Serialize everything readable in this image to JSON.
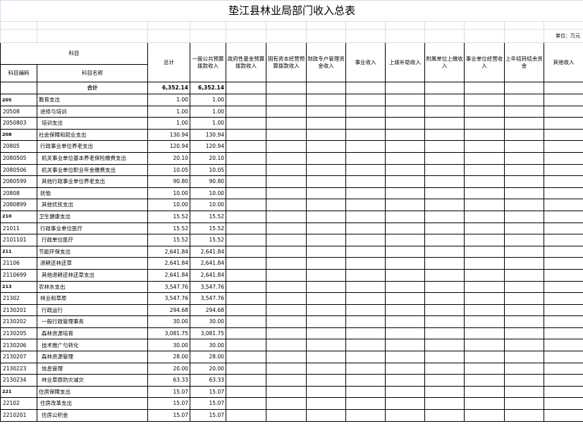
{
  "title": "垫江县林业局部门收入总表",
  "unit_label": "单位：万元",
  "headers": {
    "subject": "科目",
    "subject_code": "科目编码",
    "subject_name": "科目名称",
    "columns": [
      "总计",
      "一般公共预算拨款收入",
      "政府性基金预算拨款收入",
      "国有资本经营预算拨款收入",
      "财政专户管理资金收入",
      "事业收入",
      "上级补助收入",
      "附属单位上缴收入",
      "事业单位经营收入",
      "上年结转结余资金",
      "其他收入"
    ]
  },
  "total_row": {
    "label": "合计",
    "total": "6,352.14",
    "general": "6,352.14"
  },
  "rows": [
    {
      "code": "205",
      "name": "教育支出",
      "total": "1.00",
      "general": "1.00",
      "level": 1
    },
    {
      "code": "20508",
      "name": "进修与培训",
      "total": "1.00",
      "general": "1.00",
      "level": 2
    },
    {
      "code": "2050803",
      "name": "培训支出",
      "total": "1.00",
      "general": "1.00",
      "level": 3
    },
    {
      "code": "208",
      "name": "社会保障和就业支出",
      "total": "130.94",
      "general": "130.94",
      "level": 1
    },
    {
      "code": "20805",
      "name": "行政事业单位养老支出",
      "total": "120.94",
      "general": "120.94",
      "level": 2
    },
    {
      "code": "2080505",
      "name": "机关事业单位基本养老保险缴费支出",
      "total": "20.10",
      "general": "20.10",
      "level": 3
    },
    {
      "code": "2080506",
      "name": "机关事业单位职业年金缴费支出",
      "total": "10.05",
      "general": "10.05",
      "level": 3
    },
    {
      "code": "2080599",
      "name": "其他行政事业单位养老支出",
      "total": "90.80",
      "general": "90.80",
      "level": 3
    },
    {
      "code": "20808",
      "name": "抚恤",
      "total": "10.00",
      "general": "10.00",
      "level": 2
    },
    {
      "code": "2080899",
      "name": "其他优抚支出",
      "total": "10.00",
      "general": "10.00",
      "level": 3
    },
    {
      "code": "210",
      "name": "卫生健康支出",
      "total": "15.52",
      "general": "15.52",
      "level": 1
    },
    {
      "code": "21011",
      "name": "行政事业单位医疗",
      "total": "15.52",
      "general": "15.52",
      "level": 2
    },
    {
      "code": "2101101",
      "name": "行政单位医疗",
      "total": "15.52",
      "general": "15.52",
      "level": 3
    },
    {
      "code": "211",
      "name": "节能环保支出",
      "total": "2,641.84",
      "general": "2,641.84",
      "level": 1
    },
    {
      "code": "21106",
      "name": "退耕还林还草",
      "total": "2,641.84",
      "general": "2,641.84",
      "level": 2
    },
    {
      "code": "2110699",
      "name": "其他退耕还林还草支出",
      "total": "2,641.84",
      "general": "2,641.84",
      "level": 3
    },
    {
      "code": "213",
      "name": "农林水支出",
      "total": "3,547.76",
      "general": "3,547.76",
      "level": 1
    },
    {
      "code": "21302",
      "name": "林业和草原",
      "total": "3,547.76",
      "general": "3,547.76",
      "level": 2
    },
    {
      "code": "2130201",
      "name": "行政运行",
      "total": "294.68",
      "general": "294.68",
      "level": 3
    },
    {
      "code": "2130202",
      "name": "一般行政管理事务",
      "total": "30.00",
      "general": "30.00",
      "level": 3
    },
    {
      "code": "2130205",
      "name": "森林资源培育",
      "total": "3,081.75",
      "general": "3,081.75",
      "level": 3
    },
    {
      "code": "2130206",
      "name": "技术推广与转化",
      "total": "30.00",
      "general": "30.00",
      "level": 3
    },
    {
      "code": "2130207",
      "name": "森林资源管理",
      "total": "28.00",
      "general": "28.00",
      "level": 3
    },
    {
      "code": "2130223",
      "name": "信息管理",
      "total": "20.00",
      "general": "20.00",
      "level": 3
    },
    {
      "code": "2130234",
      "name": "林业草原防灾减灾",
      "total": "63.33",
      "general": "63.33",
      "level": 3
    },
    {
      "code": "221",
      "name": "住房保障支出",
      "total": "15.07",
      "general": "15.07",
      "level": 1
    },
    {
      "code": "22102",
      "name": "住房改革支出",
      "total": "15.07",
      "general": "15.07",
      "level": 2
    },
    {
      "code": "2210201",
      "name": "住房公积金",
      "total": "15.07",
      "general": "15.07",
      "level": 3
    }
  ]
}
